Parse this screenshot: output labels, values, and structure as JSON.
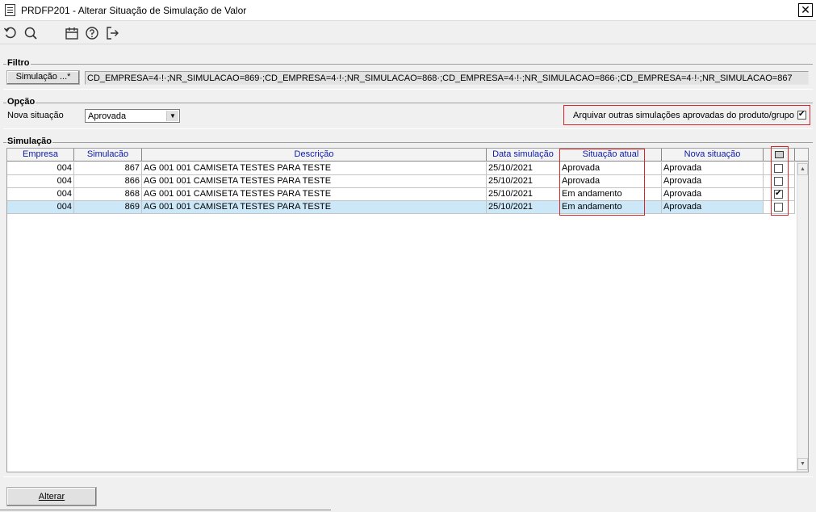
{
  "window": {
    "title": "PRDFP201 - Alterar Situação de Simulação de Valor",
    "close_glyph": "✕"
  },
  "toolbar": {
    "icons": [
      "undo-icon",
      "search-icon",
      "calendar-icon",
      "help-icon",
      "exit-icon"
    ]
  },
  "filtro": {
    "group_label": "Filtro",
    "button_label": "Simulação ...*",
    "value": "CD_EMPRESA=4·!·;NR_SIMULACAO=869·;CD_EMPRESA=4·!·;NR_SIMULACAO=868·;CD_EMPRESA=4·!·;NR_SIMULACAO=866·;CD_EMPRESA=4·!·;NR_SIMULACAO=867"
  },
  "opcao": {
    "group_label": "Opção",
    "nova_situacao_label": "Nova situação",
    "nova_situacao_value": "Aprovada",
    "arquivar_label": "Arquivar outras simulações aprovadas do produto/grupo",
    "arquivar_checked": true
  },
  "simulacao": {
    "group_label": "Simulação",
    "columns": [
      "Empresa",
      "Simulacão",
      "Descrição",
      "Data simulação",
      "Situação atual",
      "Nova situação"
    ],
    "rows": [
      {
        "empresa": "004",
        "simulacao": "867",
        "descricao": "AG 001 001 CAMISETA TESTES PARA TESTE",
        "data": "25/10/2021",
        "situacao_atual": "Aprovada",
        "nova_situacao": "Aprovada",
        "checked": false
      },
      {
        "empresa": "004",
        "simulacao": "866",
        "descricao": "AG 001 001 CAMISETA TESTES PARA TESTE",
        "data": "25/10/2021",
        "situacao_atual": "Aprovada",
        "nova_situacao": "Aprovada",
        "checked": false
      },
      {
        "empresa": "004",
        "simulacao": "868",
        "descricao": "AG 001 001 CAMISETA TESTES PARA TESTE",
        "data": "25/10/2021",
        "situacao_atual": "Em andamento",
        "nova_situacao": "Aprovada",
        "checked": true
      },
      {
        "empresa": "004",
        "simulacao": "869",
        "descricao": "AG 001 001 CAMISETA TESTES PARA TESTE",
        "data": "25/10/2021",
        "situacao_atual": "Em andamento",
        "nova_situacao": "Aprovada",
        "checked": false
      }
    ]
  },
  "footer": {
    "alterar_label": "Alterar"
  },
  "colors": {
    "header_text": "#0c1aa5",
    "highlight_border": "#d9252a",
    "selected_row": "#cce8f8"
  }
}
